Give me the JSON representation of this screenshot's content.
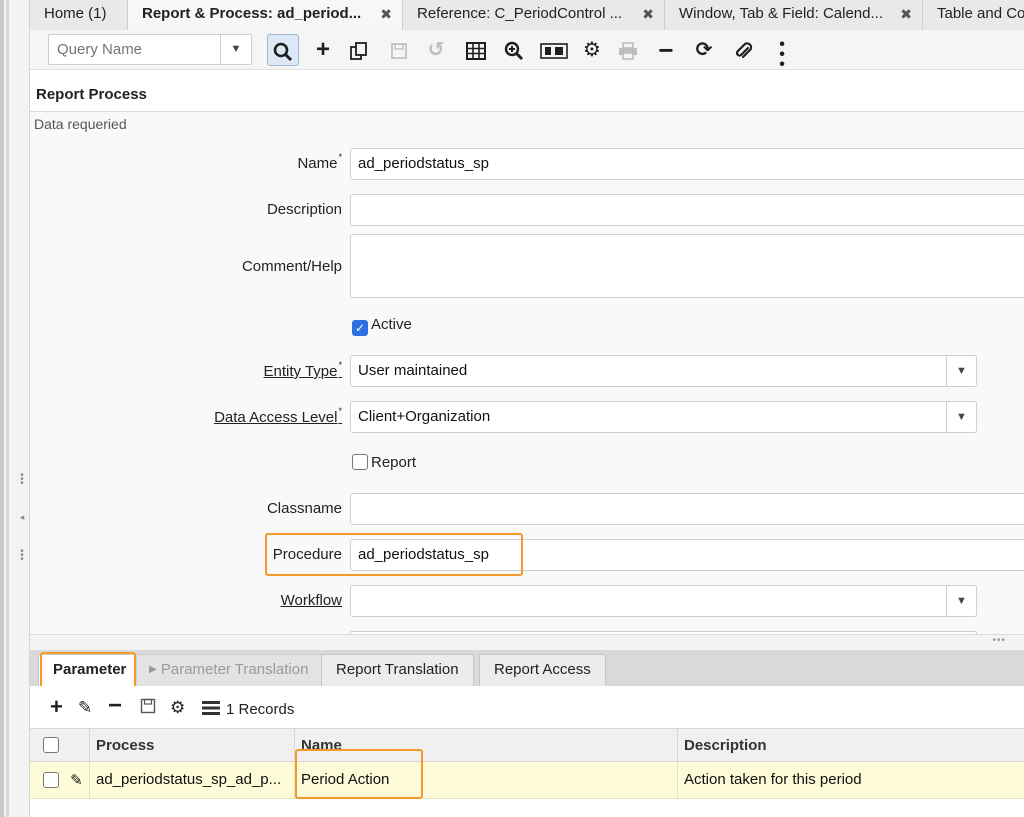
{
  "tabs": [
    {
      "label": "Home (1)",
      "closable": false
    },
    {
      "label": "Report & Process: ad_period...",
      "closable": true,
      "active": true
    },
    {
      "label": "Reference: C_PeriodControl ...",
      "closable": true
    },
    {
      "label": "Window, Tab & Field: Calend...",
      "closable": true
    },
    {
      "label": "Table and Co",
      "closable": false
    }
  ],
  "toolbar": {
    "query_placeholder": "Query Name",
    "icons": [
      "search-icon",
      "new-icon",
      "copy-icon",
      "save-icon",
      "undo-icon",
      "grid-toggle-icon",
      "zoom-icon",
      "report-icon",
      "process-icon",
      "print-icon",
      "delete-icon",
      "refresh-icon",
      "attachment-icon",
      "more-icon"
    ]
  },
  "form": {
    "section_title": "Report Process",
    "status": "Data requeried",
    "name_label": "Name",
    "name_value": "ad_periodstatus_sp",
    "description_label": "Description",
    "description_value": "",
    "comment_label": "Comment/Help",
    "comment_value": "",
    "active_label": "Active",
    "active_checked": true,
    "entity_type_label": "Entity Type",
    "entity_type_value": "User maintained",
    "data_access_label": "Data Access Level",
    "data_access_value": "Client+Organization",
    "report_label": "Report",
    "report_checked": false,
    "classname_label": "Classname",
    "classname_value": "",
    "procedure_label": "Procedure",
    "procedure_value": "ad_periodstatus_sp",
    "workflow_label": "Workflow",
    "workflow_value": "",
    "required_mark": "*"
  },
  "detail_tabs": [
    {
      "label": "Parameter",
      "active": true
    },
    {
      "label": "Parameter Translation",
      "disabled": true
    },
    {
      "label": "Report Translation"
    },
    {
      "label": "Report Access"
    }
  ],
  "grid": {
    "records_label": "1 Records",
    "columns": [
      "Process",
      "Name",
      "Description"
    ],
    "rows": [
      {
        "process": "ad_periodstatus_sp_ad_p...",
        "name": "Period Action",
        "description": "Action taken for this period"
      }
    ]
  },
  "colors": {
    "highlight": "#f39a2b",
    "selected_row": "#fdfbd8",
    "checkbox_accent": "#2d6fe0"
  }
}
